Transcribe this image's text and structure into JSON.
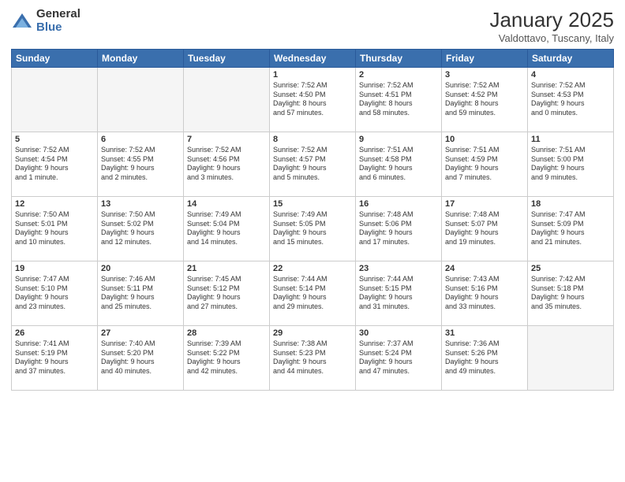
{
  "header": {
    "logo_general": "General",
    "logo_blue": "Blue",
    "month_title": "January 2025",
    "location": "Valdottavo, Tuscany, Italy"
  },
  "weekdays": [
    "Sunday",
    "Monday",
    "Tuesday",
    "Wednesday",
    "Thursday",
    "Friday",
    "Saturday"
  ],
  "weeks": [
    [
      {
        "day": "",
        "info": ""
      },
      {
        "day": "",
        "info": ""
      },
      {
        "day": "",
        "info": ""
      },
      {
        "day": "1",
        "info": "Sunrise: 7:52 AM\nSunset: 4:50 PM\nDaylight: 8 hours\nand 57 minutes."
      },
      {
        "day": "2",
        "info": "Sunrise: 7:52 AM\nSunset: 4:51 PM\nDaylight: 8 hours\nand 58 minutes."
      },
      {
        "day": "3",
        "info": "Sunrise: 7:52 AM\nSunset: 4:52 PM\nDaylight: 8 hours\nand 59 minutes."
      },
      {
        "day": "4",
        "info": "Sunrise: 7:52 AM\nSunset: 4:53 PM\nDaylight: 9 hours\nand 0 minutes."
      }
    ],
    [
      {
        "day": "5",
        "info": "Sunrise: 7:52 AM\nSunset: 4:54 PM\nDaylight: 9 hours\nand 1 minute."
      },
      {
        "day": "6",
        "info": "Sunrise: 7:52 AM\nSunset: 4:55 PM\nDaylight: 9 hours\nand 2 minutes."
      },
      {
        "day": "7",
        "info": "Sunrise: 7:52 AM\nSunset: 4:56 PM\nDaylight: 9 hours\nand 3 minutes."
      },
      {
        "day": "8",
        "info": "Sunrise: 7:52 AM\nSunset: 4:57 PM\nDaylight: 9 hours\nand 5 minutes."
      },
      {
        "day": "9",
        "info": "Sunrise: 7:51 AM\nSunset: 4:58 PM\nDaylight: 9 hours\nand 6 minutes."
      },
      {
        "day": "10",
        "info": "Sunrise: 7:51 AM\nSunset: 4:59 PM\nDaylight: 9 hours\nand 7 minutes."
      },
      {
        "day": "11",
        "info": "Sunrise: 7:51 AM\nSunset: 5:00 PM\nDaylight: 9 hours\nand 9 minutes."
      }
    ],
    [
      {
        "day": "12",
        "info": "Sunrise: 7:50 AM\nSunset: 5:01 PM\nDaylight: 9 hours\nand 10 minutes."
      },
      {
        "day": "13",
        "info": "Sunrise: 7:50 AM\nSunset: 5:02 PM\nDaylight: 9 hours\nand 12 minutes."
      },
      {
        "day": "14",
        "info": "Sunrise: 7:49 AM\nSunset: 5:04 PM\nDaylight: 9 hours\nand 14 minutes."
      },
      {
        "day": "15",
        "info": "Sunrise: 7:49 AM\nSunset: 5:05 PM\nDaylight: 9 hours\nand 15 minutes."
      },
      {
        "day": "16",
        "info": "Sunrise: 7:48 AM\nSunset: 5:06 PM\nDaylight: 9 hours\nand 17 minutes."
      },
      {
        "day": "17",
        "info": "Sunrise: 7:48 AM\nSunset: 5:07 PM\nDaylight: 9 hours\nand 19 minutes."
      },
      {
        "day": "18",
        "info": "Sunrise: 7:47 AM\nSunset: 5:09 PM\nDaylight: 9 hours\nand 21 minutes."
      }
    ],
    [
      {
        "day": "19",
        "info": "Sunrise: 7:47 AM\nSunset: 5:10 PM\nDaylight: 9 hours\nand 23 minutes."
      },
      {
        "day": "20",
        "info": "Sunrise: 7:46 AM\nSunset: 5:11 PM\nDaylight: 9 hours\nand 25 minutes."
      },
      {
        "day": "21",
        "info": "Sunrise: 7:45 AM\nSunset: 5:12 PM\nDaylight: 9 hours\nand 27 minutes."
      },
      {
        "day": "22",
        "info": "Sunrise: 7:44 AM\nSunset: 5:14 PM\nDaylight: 9 hours\nand 29 minutes."
      },
      {
        "day": "23",
        "info": "Sunrise: 7:44 AM\nSunset: 5:15 PM\nDaylight: 9 hours\nand 31 minutes."
      },
      {
        "day": "24",
        "info": "Sunrise: 7:43 AM\nSunset: 5:16 PM\nDaylight: 9 hours\nand 33 minutes."
      },
      {
        "day": "25",
        "info": "Sunrise: 7:42 AM\nSunset: 5:18 PM\nDaylight: 9 hours\nand 35 minutes."
      }
    ],
    [
      {
        "day": "26",
        "info": "Sunrise: 7:41 AM\nSunset: 5:19 PM\nDaylight: 9 hours\nand 37 minutes."
      },
      {
        "day": "27",
        "info": "Sunrise: 7:40 AM\nSunset: 5:20 PM\nDaylight: 9 hours\nand 40 minutes."
      },
      {
        "day": "28",
        "info": "Sunrise: 7:39 AM\nSunset: 5:22 PM\nDaylight: 9 hours\nand 42 minutes."
      },
      {
        "day": "29",
        "info": "Sunrise: 7:38 AM\nSunset: 5:23 PM\nDaylight: 9 hours\nand 44 minutes."
      },
      {
        "day": "30",
        "info": "Sunrise: 7:37 AM\nSunset: 5:24 PM\nDaylight: 9 hours\nand 47 minutes."
      },
      {
        "day": "31",
        "info": "Sunrise: 7:36 AM\nSunset: 5:26 PM\nDaylight: 9 hours\nand 49 minutes."
      },
      {
        "day": "",
        "info": ""
      }
    ]
  ]
}
